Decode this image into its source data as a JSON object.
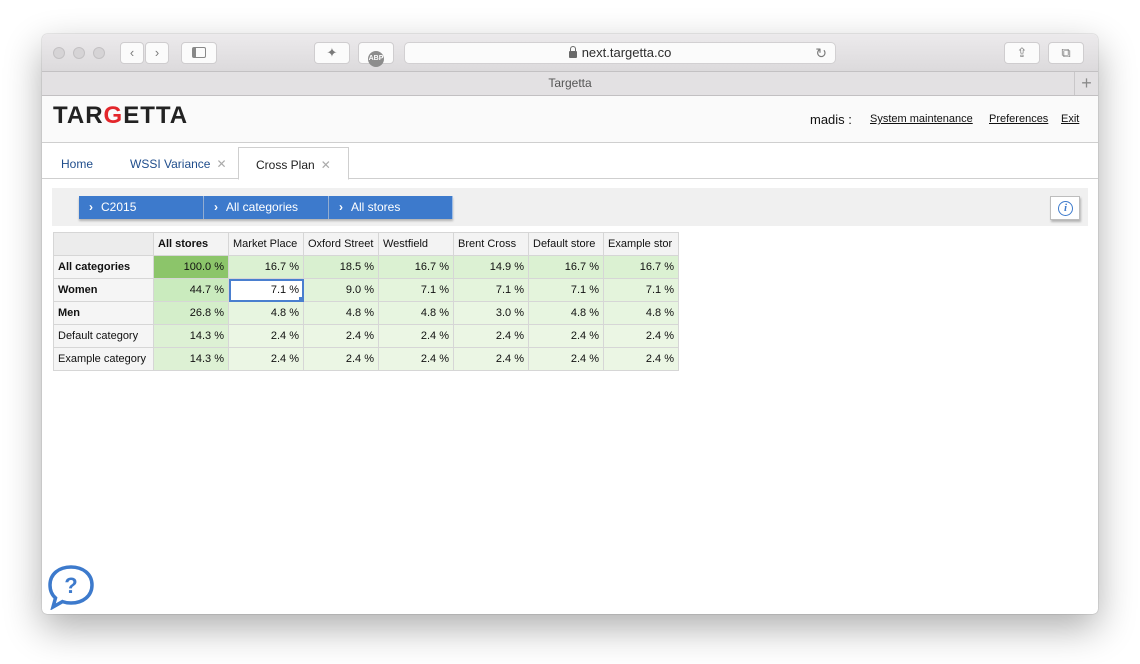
{
  "browser": {
    "address": "next.targetta.co",
    "tab_title": "Targetta",
    "adblock_label": "ABP"
  },
  "header": {
    "logo_pre": "TAR",
    "logo_g": "G",
    "logo_post": "ETTA",
    "user": "madis :",
    "links": [
      "System maintenance",
      "Preferences",
      "Exit"
    ]
  },
  "tabs": [
    {
      "label": "Home",
      "closable": false
    },
    {
      "label": "WSSI Variance",
      "closable": true
    },
    {
      "label": "Cross Plan",
      "closable": true,
      "active": true
    }
  ],
  "filters": [
    "C2015",
    "All categories",
    "All stores"
  ],
  "colors": {
    "accent": "#3d7acc",
    "logo_red": "#e3262b"
  },
  "grid": {
    "columns": [
      "All stores",
      "Market Place",
      "Oxford Street",
      "Westfield",
      "Brent Cross",
      "Default store",
      "Example stor"
    ],
    "rows": [
      {
        "label": "All categories",
        "bold": true,
        "values": [
          "100.0 %",
          "16.7 %",
          "18.5 %",
          "16.7 %",
          "14.9 %",
          "16.7 %",
          "16.7 %"
        ],
        "heat": [
          1.0,
          0.167,
          0.185,
          0.167,
          0.149,
          0.167,
          0.167
        ]
      },
      {
        "label": "Women",
        "bold": true,
        "values": [
          "44.7 %",
          "7.1 %",
          "9.0 %",
          "7.1 %",
          "7.1 %",
          "7.1 %",
          "7.1 %"
        ],
        "heat": [
          0.447,
          0.071,
          0.09,
          0.071,
          0.071,
          0.071,
          0.071
        ]
      },
      {
        "label": "Men",
        "bold": true,
        "values": [
          "26.8 %",
          "4.8 %",
          "4.8 %",
          "4.8 %",
          "3.0 %",
          "4.8 %",
          "4.8 %"
        ],
        "heat": [
          0.268,
          0.048,
          0.048,
          0.048,
          0.03,
          0.048,
          0.048
        ]
      },
      {
        "label": "Default category",
        "bold": false,
        "values": [
          "14.3 %",
          "2.4 %",
          "2.4 %",
          "2.4 %",
          "2.4 %",
          "2.4 %",
          "2.4 %"
        ],
        "heat": [
          0.143,
          0.024,
          0.024,
          0.024,
          0.024,
          0.024,
          0.024
        ]
      },
      {
        "label": "Example category",
        "bold": false,
        "values": [
          "14.3 %",
          "2.4 %",
          "2.4 %",
          "2.4 %",
          "2.4 %",
          "2.4 %",
          "2.4 %"
        ],
        "heat": [
          0.143,
          0.024,
          0.024,
          0.024,
          0.024,
          0.024,
          0.024
        ]
      }
    ],
    "selected": {
      "row": 1,
      "col": 1
    }
  },
  "icons": [
    "back-icon",
    "forward-icon",
    "sidebar-icon",
    "extension-icon",
    "adblock-icon",
    "lock-icon",
    "reload-icon",
    "share-icon",
    "tabs-icon",
    "new-tab-icon",
    "info-icon",
    "help-chat-icon",
    "chevron-right-icon"
  ]
}
